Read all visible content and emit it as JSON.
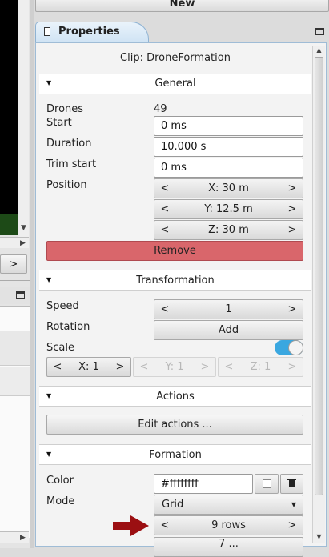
{
  "top_button": {
    "label": "New"
  },
  "panel": {
    "tab_title": "Properties",
    "clip_title": "Clip: DroneFormation"
  },
  "general": {
    "title": "General",
    "drones_label": "Drones",
    "drones_value": "49",
    "start_label": "Start",
    "start_value": "0 ms",
    "duration_label": "Duration",
    "duration_value": "10.000 s",
    "trim_label": "Trim start",
    "trim_value": "0 ms",
    "position_label": "Position",
    "pos_x": "X: 30 m",
    "pos_y": "Y: 12.5 m",
    "pos_z": "Z: 30 m",
    "remove_label": "Remove"
  },
  "transformation": {
    "title": "Transformation",
    "speed_label": "Speed",
    "speed_value": "1",
    "rotation_label": "Rotation",
    "rotation_button": "Add",
    "scale_label": "Scale",
    "scale_on": true,
    "scale_x": "X: 1",
    "scale_y": "Y: 1",
    "scale_z": "Z: 1"
  },
  "actions": {
    "title": "Actions",
    "edit_button": "Edit actions ..."
  },
  "formation": {
    "title": "Formation",
    "color_label": "Color",
    "color_value": "#ffffffff",
    "mode_label": "Mode",
    "mode_value": "Grid",
    "rows_value": "9 rows",
    "partial_value": "7 ..."
  },
  "left_panel": {
    "next_button": ">"
  },
  "glyphs": {
    "left": "<",
    "right": ">",
    "dropdown": "▾"
  },
  "colors": {
    "remove_bg": "#d9666b",
    "toggle_on": "#3aa7e0",
    "arrow": "#9b0f12"
  }
}
